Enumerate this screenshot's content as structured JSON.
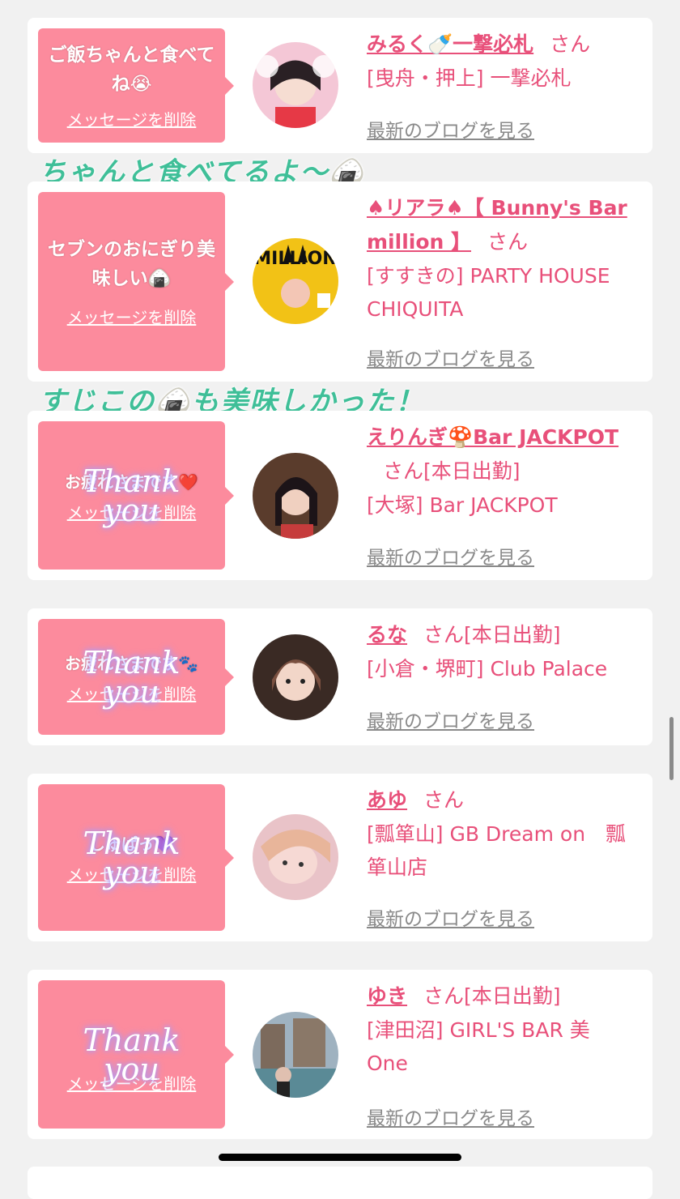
{
  "common": {
    "delete_label": "メッセージを削除",
    "blog_label": "最新のブログを見る",
    "san": "さん",
    "thank_top": "Thank",
    "thank_bottom": "you"
  },
  "overlays": [
    "ちゃんと食べてるよ〜🍙",
    "すじこの🍙も美味しかった！"
  ],
  "messages": [
    {
      "message": "ご飯ちゃんと食べてね😭",
      "name": "みるく🍼一撃必札",
      "status": "",
      "shop_line1": "[曳舟・押上] 一撃必札",
      "shop_line2": ""
    },
    {
      "message": "セブンのおにぎり美味しい🍙",
      "name": "♠リアラ♠【 Bunny's Bar million 】",
      "status": "",
      "shop_line1": "[すすきの] PARTY HOUSE",
      "shop_line2": "CHIQUITA"
    },
    {
      "message": "お疲れさまです❤️",
      "name": "えりんぎ🍄Bar JACKPOT",
      "status": "[本日出勤]",
      "shop_line1": "[大塚] Bar JACKPOT",
      "shop_line2": ""
    },
    {
      "message": "お疲れさまです🐾",
      "name": "るな",
      "status": "[本日出勤]",
      "shop_line1": "[小倉・堺町] Club Palace",
      "shop_line2": ""
    },
    {
      "message": "しゅぱっ💜",
      "name": "あゆ",
      "status": "",
      "shop_line1": "[瓢箪山] GB Dream on　瓢",
      "shop_line2": "箪山店"
    },
    {
      "message": "",
      "name": "ゆき",
      "status": "[本日出勤]",
      "shop_line1": "[津田沼] GIRL'S BAR 美",
      "shop_line2": "One"
    }
  ]
}
